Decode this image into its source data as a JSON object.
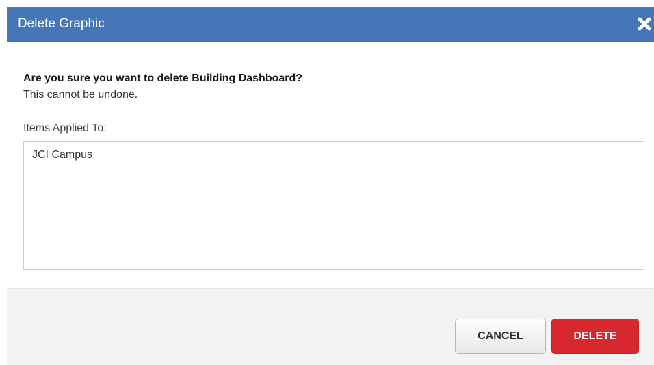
{
  "dialog": {
    "title": "Delete Graphic",
    "close_icon": "close-icon"
  },
  "message": {
    "question": "Are you sure you want to delete Building Dashboard?",
    "warning": "This cannot be undone."
  },
  "items": {
    "label": "Items Applied To:",
    "list": [
      "JCI Campus"
    ]
  },
  "buttons": {
    "cancel": "CANCEL",
    "delete": "DELETE"
  },
  "colors": {
    "titlebar": "#4577b8",
    "delete_button": "#d7282f",
    "footer": "#f2f2f2"
  }
}
